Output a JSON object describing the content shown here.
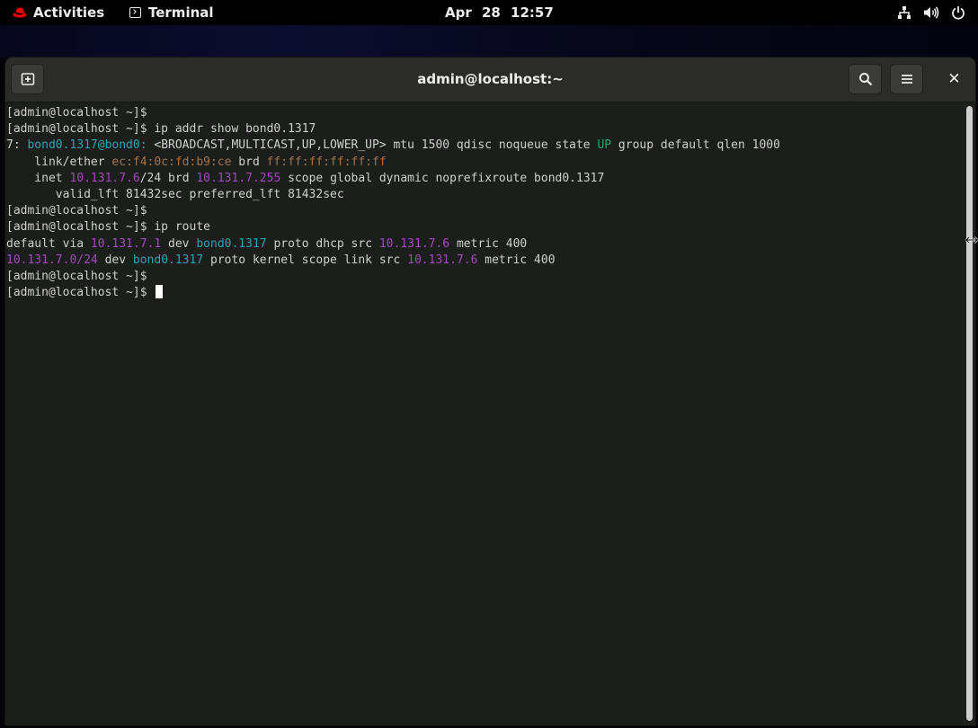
{
  "topbar": {
    "activities_label": "Activities",
    "app_menu_label": "Terminal",
    "clock": "Apr 28 12:57",
    "icons": [
      "redhat-logo-icon",
      "terminal-app-icon",
      "network-icon",
      "volume-icon",
      "power-icon"
    ]
  },
  "window": {
    "title": "admin@localhost:~",
    "buttons": [
      "new-tab-icon",
      "search-icon",
      "hamburger-menu-icon",
      "close-icon"
    ]
  },
  "terminal": {
    "lines": [
      [
        {
          "t": "[admin@localhost ~]$ "
        }
      ],
      [
        {
          "t": "[admin@localhost ~]$ ip addr show bond0.1317"
        }
      ],
      [
        {
          "t": "7: "
        },
        {
          "t": "bond0.1317@bond0:",
          "c": "teal"
        },
        {
          "t": " <BROADCAST,MULTICAST,UP,LOWER_UP> mtu 1500 qdisc noqueue state "
        },
        {
          "t": "UP",
          "c": "green"
        },
        {
          "t": " group default qlen 1000"
        }
      ],
      [
        {
          "t": "    link/ether "
        },
        {
          "t": "ec:f4:0c:fd:b9:ce",
          "c": "orange"
        },
        {
          "t": " brd "
        },
        {
          "t": "ff:ff:ff:ff:ff:ff",
          "c": "orange"
        }
      ],
      [
        {
          "t": "    inet "
        },
        {
          "t": "10.131.7.6",
          "c": "purple"
        },
        {
          "t": "/24 brd "
        },
        {
          "t": "10.131.7.255",
          "c": "purple"
        },
        {
          "t": " scope global dynamic noprefixroute bond0.1317"
        }
      ],
      [
        {
          "t": "       valid_lft 81432sec preferred_lft 81432sec"
        }
      ],
      [
        {
          "t": "[admin@localhost ~]$ "
        }
      ],
      [
        {
          "t": "[admin@localhost ~]$ ip route"
        }
      ],
      [
        {
          "t": "default via "
        },
        {
          "t": "10.131.7.1",
          "c": "purple"
        },
        {
          "t": " dev "
        },
        {
          "t": "bond0.1317",
          "c": "teal"
        },
        {
          "t": " proto dhcp src "
        },
        {
          "t": "10.131.7.6",
          "c": "purple"
        },
        {
          "t": " metric 400"
        }
      ],
      [
        {
          "t": "10.131.7.0/24",
          "c": "purple"
        },
        {
          "t": " dev "
        },
        {
          "t": "bond0.1317",
          "c": "teal"
        },
        {
          "t": " proto kernel scope link src "
        },
        {
          "t": "10.131.7.6",
          "c": "purple"
        },
        {
          "t": " metric 400"
        }
      ],
      [
        {
          "t": "[admin@localhost ~]$ "
        }
      ],
      [
        {
          "t": "[admin@localhost ~]$ "
        }
      ]
    ],
    "colors": {
      "fg": "#d0d0cc",
      "teal": "#2aa1b3",
      "green": "#26a269",
      "orange": "#a2734c",
      "purple": "#a347ba",
      "bg": "#1c1e1c"
    }
  }
}
